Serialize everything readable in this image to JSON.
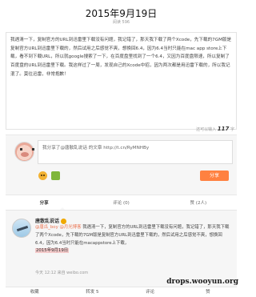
{
  "page": {
    "title": "2015年9月19日",
    "read_count": "阅读 596"
  },
  "article": {
    "text": "我遇清一下，复制官方的URL到迅雷里下载没有问题，我记错了，那天我下载了两个Xcode，先下载的7GM版是复制官方URL到迅雷里下载的，然后试用之后感觉不爽，想换回6.4，因为6.4当时只能在mac app store上下载，看不到下载URL，所以就google搜索了一下，在百度盘里找到了一个6.4，又因为百度盘限速，所以复制了百度盘的URL到迅雷里下载。我这样过了一周，发现自己的Xcode中招，因为两次都是用迅雷下载的，所以我记混了。莫往迅雷，非常抱歉！"
  },
  "composer": {
    "limit_prefix": "还可以输入",
    "limit_count": "117",
    "limit_suffix": "字",
    "prefill": "我分享了@唐散乱说话 的文章 http://t.cn/RyMNHBy",
    "share_label": "分享"
  },
  "tabs": [
    {
      "label": "分享"
    },
    {
      "label": "评论 (0)"
    },
    {
      "label": "赞 (2人)"
    }
  ],
  "post": {
    "author": "唐散乱说话",
    "body_prefix": "我遇清一下，复制官方的URL到迅雷里下载没有问题，我记错了，那天我下载了两个Xcode，先下载的7GM版是复制官方URL到迅雷里下载的，然后试用之后感觉不爽，想换回6.4，因为6.4当时只能在macappstore上下载，",
    "mention_1": "@唐瓜_boy",
    "mention_2": "@月光博客",
    "highlight": "2015年9月19日",
    "meta": "今天 12:12 来自 weibo.com"
  },
  "actions": [
    {
      "label": "收藏"
    },
    {
      "label": "转发 5"
    },
    {
      "label": "评论"
    },
    {
      "label": "赞"
    }
  ],
  "watermark": "drops.wooyun.org"
}
